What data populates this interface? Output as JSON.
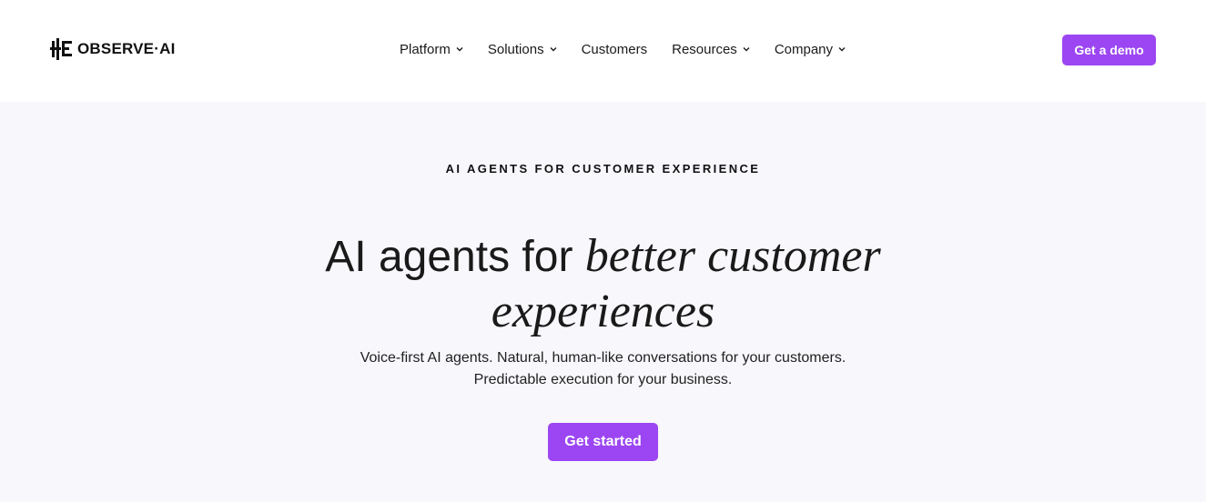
{
  "header": {
    "logo_text": "OBSERVE·AI",
    "nav": [
      {
        "label": "Platform",
        "has_dropdown": true
      },
      {
        "label": "Solutions",
        "has_dropdown": true
      },
      {
        "label": "Customers",
        "has_dropdown": false
      },
      {
        "label": "Resources",
        "has_dropdown": true
      },
      {
        "label": "Company",
        "has_dropdown": true
      }
    ],
    "demo_button": "Get a demo"
  },
  "hero": {
    "eyebrow": "AI AGENTS FOR CUSTOMER EXPERIENCE",
    "headline_plain": "AI agents for ",
    "headline_serif_1": "better customer",
    "headline_serif_2": "experiences",
    "subtitle_line_1": "Voice-first AI agents. Natural, human-like conversations for your customers.",
    "subtitle_line_2": "Predictable execution for your business.",
    "cta_button": "Get started"
  },
  "colors": {
    "accent": "#9b46f2",
    "hero_background": "#f8f7fc",
    "text": "#1a1a1a"
  },
  "icons": {
    "logo": "observe-ai-logo-icon",
    "dropdown": "chevron-down-icon"
  }
}
